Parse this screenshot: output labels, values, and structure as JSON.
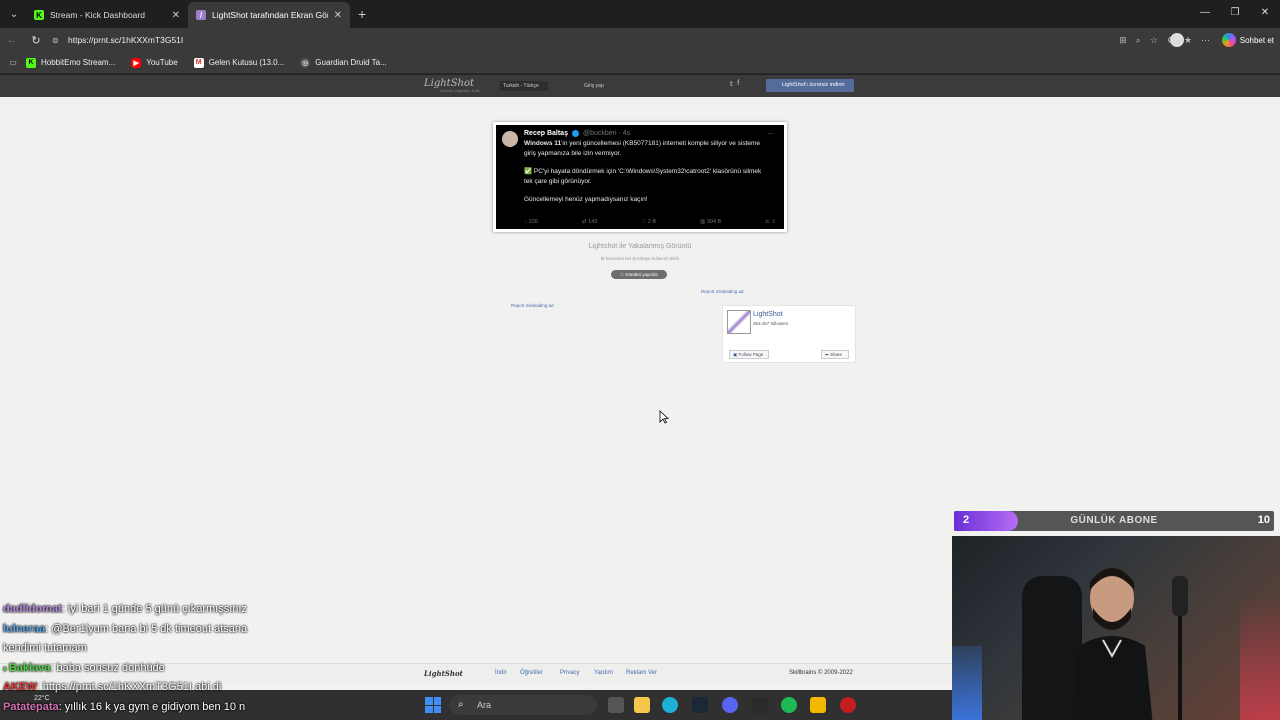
{
  "browser": {
    "tabs": [
      {
        "title": "Stream - Kick Dashboard",
        "active": false,
        "favicon": "kick-icon"
      },
      {
        "title": "LightShot tarafından Ekran Görünt",
        "active": true,
        "favicon": "lightshot-icon"
      }
    ],
    "url": "https://prnt.sc/1hKXXmT3G51I",
    "copilot_label": "Sohbet et",
    "bookmarks": [
      {
        "label": "HobbitEmo Stream...",
        "icon": "kick-icon"
      },
      {
        "label": "YouTube",
        "icon": "youtube-icon"
      },
      {
        "label": "Gelen Kutusu (13.0...",
        "icon": "gmail-icon"
      },
      {
        "label": "Guardian Druid Ta...",
        "icon": "wow-icon"
      }
    ]
  },
  "lightshot": {
    "logo": "LightShot",
    "logo_sub": "screen capture tool",
    "language": "Turkish - Türkçe",
    "login": "Giriş yap",
    "download_button": "LightShot'ı ücretsiz indirin",
    "caption": "Lightshot ile Yakalanmış Görüntü",
    "small_links": "⊟ benzerini bul   ⊟ kötüye kullanım bildir",
    "publish_button": "⤫ Gönderi yayımla",
    "report_ad_1": "Report misleading ad",
    "report_ad_2": "Report misleading ad",
    "fb": {
      "name": "LightShot",
      "followers": "363,457 followers",
      "follow": "Follow Page",
      "share": "Share"
    },
    "footer": {
      "logo": "LightShot",
      "links": [
        "İndir",
        "Öğretiler",
        "Privacy",
        "Yardım",
        "Reklam Ver"
      ],
      "copyright": "Skillbrains © 2009-2022"
    }
  },
  "tweet": {
    "name": "Recep Baltaş",
    "handle": "@buckberi · 4s",
    "line1_bold": "Windows 11",
    "line1": "'in yeni güncellemesi (KB5077181) interneti komple siliyor ve sisteme giriş yapmanıza bile izin vermiyor.",
    "line2": "✅ PC'yi hayata döndürmek için 'C:\\Windows\\System32\\catroot2' klasörünü silmek tek çare gibi görünüyor.",
    "line3": "Güncellemeyi henüz yapmadıysanız kaçın!",
    "replies": "226",
    "retweets": "143",
    "likes": "2 B",
    "views": "304 B"
  },
  "chat": [
    {
      "user": "dadlidomat",
      "color": "#b58ad9",
      "message": ": iyi bari 1 günde 5 günü çıkarmışsınız"
    },
    {
      "user": "lulneraa",
      "color": "#5aa0e0",
      "message": ": @Ber1lyum bana bi 5 dk timeout atsana"
    },
    {
      "user": "",
      "color": "#ffffff",
      "message": "kendimi tutamam"
    },
    {
      "user": "Baklava",
      "color": "#55d34a",
      "message": ": baba sonsuz donhüde"
    },
    {
      "user": "AKEW",
      "color": "#e03a3a",
      "message": ": https://prnt.sc/1hKXXmT3G51I abi di"
    },
    {
      "user": "Patatepata",
      "color": "#d070b0",
      "message": ": yıllık 16 k ya gym e gidiyom ben 10 n"
    }
  ],
  "sub_goal": {
    "current": "2",
    "goal": "10",
    "label": "GÜNLÜK ABONE",
    "progress": 0.2
  },
  "taskbar": {
    "weather": "22°C",
    "search_placeholder": "Ara"
  },
  "colors": {
    "accent": "#6a2fd6",
    "link": "#4a6eb0",
    "page_bg": "#f1f1ef"
  }
}
